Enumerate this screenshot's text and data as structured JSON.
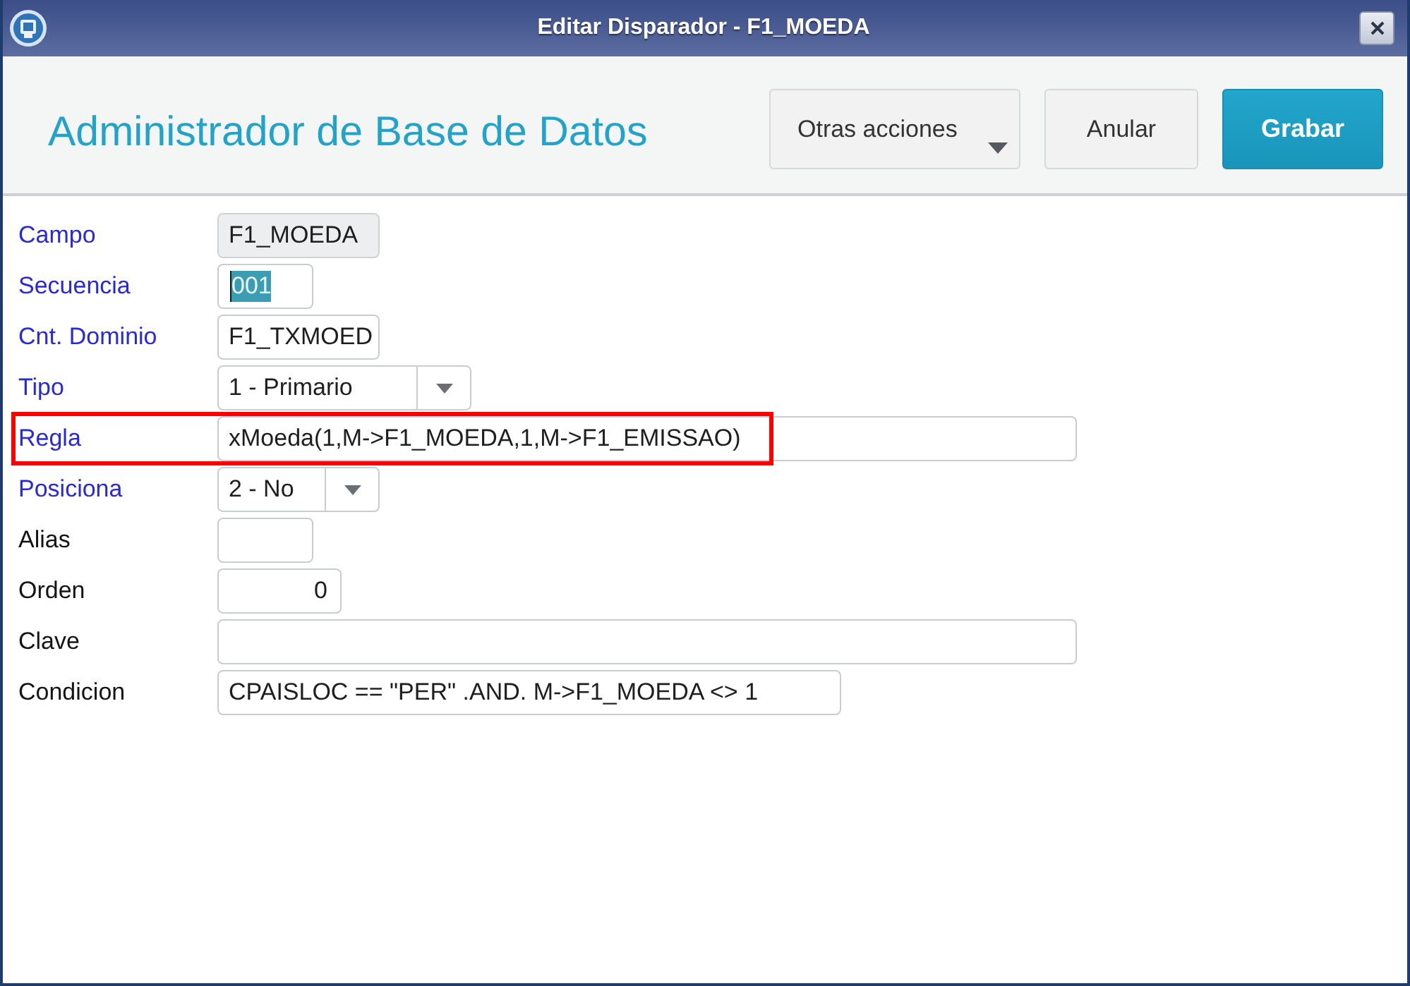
{
  "window": {
    "title": "Editar Disparador - F1_MOEDA"
  },
  "header": {
    "title": "Administrador de Base de Datos",
    "buttons": [
      {
        "label": "Otras acciones",
        "kind": "menu"
      },
      {
        "label": "Anular",
        "kind": "secondary"
      },
      {
        "label": "Grabar",
        "kind": "primary"
      }
    ]
  },
  "fields": [
    {
      "label": "Campo",
      "required": true,
      "kind": "text",
      "value": "F1_MOEDA",
      "disabled": true,
      "text_selected": false,
      "highlighted": false
    },
    {
      "label": "Secuencia",
      "required": true,
      "kind": "text",
      "value": "001",
      "disabled": false,
      "text_selected": true,
      "highlighted": false
    },
    {
      "label": "Cnt. Dominio",
      "required": true,
      "kind": "text",
      "value": "F1_TXMOED",
      "disabled": false,
      "text_selected": false,
      "highlighted": false
    },
    {
      "label": "Tipo",
      "required": true,
      "kind": "select",
      "value": "1 - Primario",
      "disabled": false,
      "text_selected": false,
      "highlighted": false
    },
    {
      "label": "Regla",
      "required": true,
      "kind": "text",
      "value": "xMoeda(1,M->F1_MOEDA,1,M->F1_EMISSAO)",
      "disabled": false,
      "text_selected": false,
      "highlighted": true
    },
    {
      "label": "Posiciona",
      "required": true,
      "kind": "select",
      "value": "2 - No",
      "disabled": false,
      "text_selected": false,
      "highlighted": false
    },
    {
      "label": "Alias",
      "required": false,
      "kind": "text",
      "disabled": false,
      "text_selected": false,
      "highlighted": false
    },
    {
      "label": "Orden",
      "required": false,
      "kind": "number",
      "value": "0",
      "disabled": false,
      "text_selected": false,
      "highlighted": false
    },
    {
      "label": "Clave",
      "required": false,
      "kind": "text",
      "disabled": false,
      "text_selected": false,
      "highlighted": false
    },
    {
      "label": "Condicion",
      "required": false,
      "kind": "text",
      "value": "CPAISLOC == \"PER\" .AND. M->F1_MOEDA <> 1",
      "disabled": false,
      "text_selected": false,
      "highlighted": false
    }
  ]
}
